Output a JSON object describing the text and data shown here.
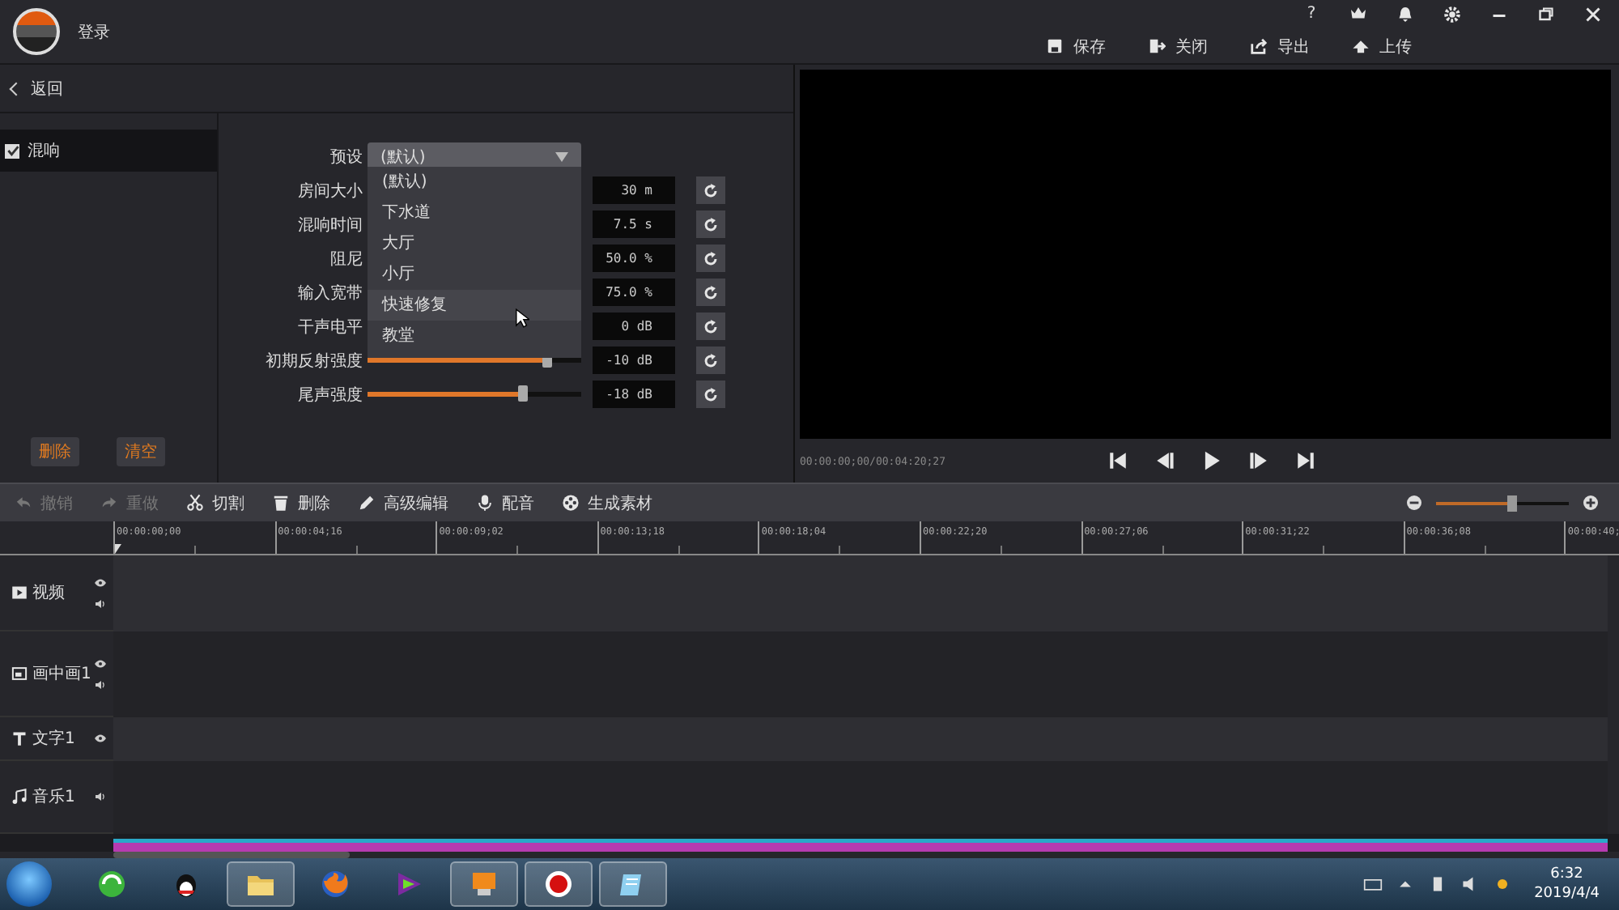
{
  "header": {
    "login": "登录",
    "help": "?",
    "actions": [
      "保存",
      "关闭",
      "导出",
      "上传"
    ]
  },
  "back": "返回",
  "effects": [
    {
      "label": "混响",
      "checked": true,
      "selected": true
    }
  ],
  "effect_buttons": [
    "删除",
    "清空"
  ],
  "preset": {
    "label": "预设",
    "value": "(默认)",
    "expanded": true,
    "options": [
      {
        "label": "(默认)",
        "hovered": false
      },
      {
        "label": "下水道",
        "hovered": false
      },
      {
        "label": "大厅",
        "hovered": false
      },
      {
        "label": "小厅",
        "hovered": false
      },
      {
        "label": "快速修复",
        "hovered": true
      },
      {
        "label": "教堂",
        "hovered": false
      }
    ]
  },
  "params": [
    {
      "label": "房间大小",
      "value": "30 m"
    },
    {
      "label": "混响时间",
      "value": "7.5 s"
    },
    {
      "label": "阻尼",
      "value": "50.0 %"
    },
    {
      "label": "输入宽带",
      "value": "75.0 %"
    },
    {
      "label": "干声电平",
      "value": "0 dB"
    },
    {
      "label": "初期反射强度",
      "value": "-10 dB",
      "level": 0.84
    },
    {
      "label": "尾声强度",
      "value": "-18 dB",
      "level": 0.73
    }
  ],
  "player": {
    "time": "00:00:00;00/00:04:20;27"
  },
  "toolbar": [
    {
      "label": "撤销",
      "disabled": true
    },
    {
      "label": "重做",
      "disabled": true
    },
    {
      "label": "切割",
      "disabled": false
    },
    {
      "label": "删除",
      "disabled": false
    },
    {
      "label": "高级编辑",
      "disabled": false
    },
    {
      "label": "配音",
      "disabled": false
    },
    {
      "label": "生成素材",
      "disabled": false
    }
  ],
  "zoom": {
    "level": 0.57
  },
  "ruler": [
    "00:00:00;00",
    "00:00:04;16",
    "00:00:09;02",
    "00:00:13;18",
    "00:00:18;04",
    "00:00:22;20",
    "00:00:27;06",
    "00:00:31;22",
    "00:00:36;08",
    "00:00:40;"
  ],
  "tracks": [
    {
      "label": "视频",
      "visibility_toggle": true,
      "mute_toggle": true
    },
    {
      "label": "画中画1",
      "visibility_toggle": true,
      "mute_toggle": true
    },
    {
      "label": "文字1",
      "visibility_toggle": true
    },
    {
      "label": "音乐1",
      "mute_toggle": true
    }
  ],
  "taskbar": {
    "apps": [
      {
        "open": false
      },
      {
        "open": false
      },
      {
        "open": true
      },
      {
        "open": false
      },
      {
        "open": false
      },
      {
        "open": true
      },
      {
        "open": true
      },
      {
        "open": true
      }
    ],
    "time": "6:32",
    "date": "2019/4/4"
  }
}
